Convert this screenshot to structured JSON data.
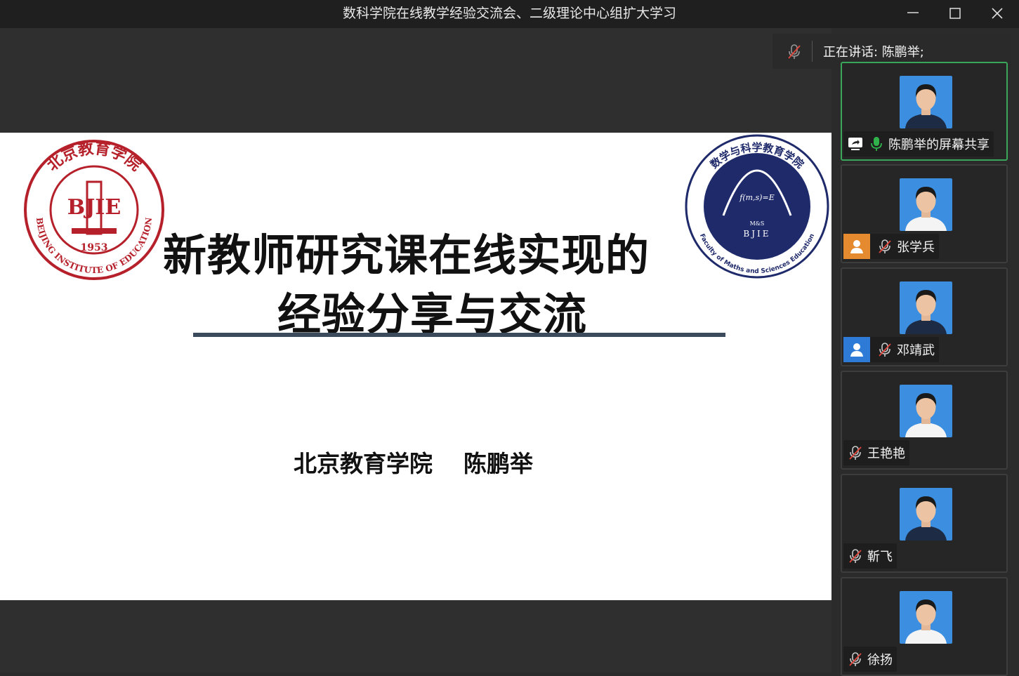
{
  "window": {
    "title": "数科学院在线教学经验交流会、二级理论中心组扩大学习",
    "controls": [
      "minimize-icon",
      "maximize-icon",
      "close-icon"
    ]
  },
  "slide": {
    "title_line1": "新教师研究课在线实现的",
    "title_line2": "经验分享与交流",
    "institution": "北京教育学院",
    "presenter": "陈鹏举",
    "logo_left": {
      "monogram": "BJIE",
      "year": "1953",
      "ring_text": "BEIJING INSTITUTE OF EDUCATION",
      "top_text": "北京教育学院"
    },
    "logo_right": {
      "top_text": "数学与科学教育学院",
      "formula": "f(m,s)=E",
      "mid_text": "M&S",
      "monogram": "BJIE",
      "ring_text": "Faculty of Maths and Sciences Education"
    }
  },
  "sidebar": {
    "speaking_label": "正在讲话: 陈鹏举;",
    "participants": [
      {
        "name": "陈鹏举的屏幕共享",
        "icon": "screen-share-icon",
        "mic": "mic-on-icon",
        "active": true
      },
      {
        "name": "张学兵",
        "badge": "person-icon",
        "badge_color": "#e58a2e",
        "mic": "mic-off-icon"
      },
      {
        "name": "邓靖武",
        "badge": "person-icon",
        "badge_color": "#2d7bd6",
        "mic": "mic-off-icon"
      },
      {
        "name": "王艳艳",
        "mic": "mic-off-icon"
      },
      {
        "name": "靳飞",
        "mic": "mic-off-icon"
      },
      {
        "name": "徐扬",
        "mic": "mic-off-icon"
      }
    ]
  },
  "colors": {
    "active_border": "#3aa65a",
    "avatar_bg": "#3b8ee0",
    "logo_red": "#b5202a",
    "logo_navy": "#1f2a6b"
  }
}
